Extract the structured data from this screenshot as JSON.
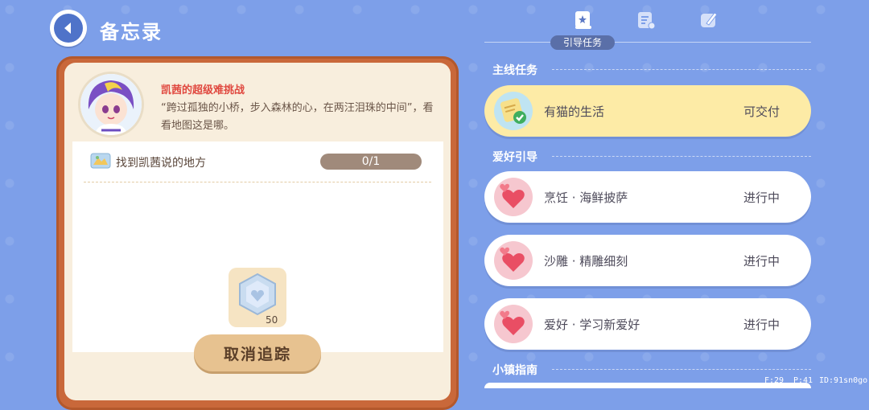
{
  "header": {
    "title": "备忘录"
  },
  "memo": {
    "quest_title": "凯茜的超级难挑战",
    "quest_desc": "“跨过孤独的小桥，步入森林的心，在两汪泪珠的中间”，看看地图这是哪。",
    "objective": {
      "text": "找到凯茜说的地方",
      "progress": "0/1"
    },
    "reward_count": "50",
    "untrack_label": "取消追踪"
  },
  "tabs": {
    "active_label": "引导任务",
    "icons": [
      "guide-book-icon",
      "task-list-icon",
      "notebook-pen-icon"
    ]
  },
  "sections": {
    "main": "主线任务",
    "hobby": "爱好引导",
    "town": "小镇指南"
  },
  "tasks": {
    "main": [
      {
        "name": "有猫的生活",
        "status": "可交付",
        "icon": "cat-check-icon"
      }
    ],
    "hobby": [
      {
        "name": "烹饪 · 海鲜披萨",
        "status": "进行中",
        "icon": "hearts-icon"
      },
      {
        "name": "沙雕 · 精雕细刻",
        "status": "进行中",
        "icon": "hearts-icon"
      },
      {
        "name": "爱好 · 学习新爱好",
        "status": "进行中",
        "icon": "hearts-icon"
      }
    ]
  },
  "debug": {
    "f": "F:29",
    "p": "P:41",
    "id": "ID:91sn0go"
  },
  "colors": {
    "background": "#7d9fe9",
    "frame": "#c9683a",
    "active_task": "#fdeba6"
  }
}
